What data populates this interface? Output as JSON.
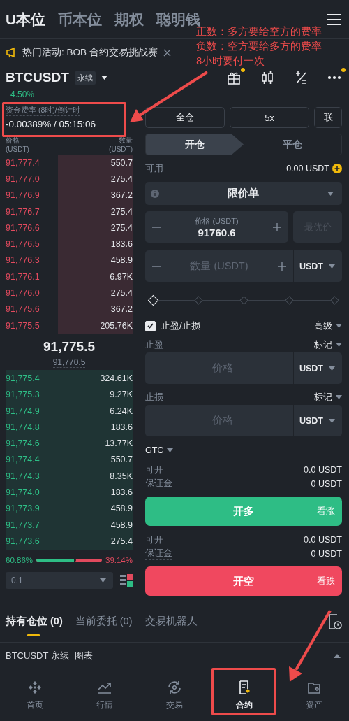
{
  "top_tabs": [
    {
      "label": "U本位",
      "selected": true
    },
    {
      "label": "币本位",
      "selected": false
    },
    {
      "label": "期权",
      "selected": false
    },
    {
      "label": "聪明钱",
      "selected": false
    }
  ],
  "announcement": {
    "text": "热门活动: BOB 合约交易挑战赛"
  },
  "symbol": {
    "name": "BTCUSDT",
    "tag": "永续",
    "change": "+4.50%"
  },
  "header_icons": [
    {
      "kind": "gift",
      "badge": true
    },
    {
      "kind": "candles",
      "badge": false
    },
    {
      "kind": "calculator",
      "badge": false
    },
    {
      "kind": "more",
      "badge": true
    }
  ],
  "funding": {
    "label": "资金费率 (8时)/倒计时",
    "value": "-0.00389% / 05:15:06"
  },
  "order_book": {
    "price_header": "价格",
    "price_unit": "(USDT)",
    "qty_header": "数量",
    "qty_unit": "(USDT)",
    "asks": [
      {
        "price": "91,777.4",
        "qty": "550.7"
      },
      {
        "price": "91,777.0",
        "qty": "275.4"
      },
      {
        "price": "91,776.9",
        "qty": "367.2"
      },
      {
        "price": "91,776.7",
        "qty": "275.4"
      },
      {
        "price": "91,776.6",
        "qty": "275.4"
      },
      {
        "price": "91,776.5",
        "qty": "183.6"
      },
      {
        "price": "91,776.3",
        "qty": "458.9"
      },
      {
        "price": "91,776.1",
        "qty": "6.97K"
      },
      {
        "price": "91,776.0",
        "qty": "275.4"
      },
      {
        "price": "91,775.6",
        "qty": "367.2"
      },
      {
        "price": "91,775.5",
        "qty": "205.76K"
      }
    ],
    "last_price": "91,775.5",
    "mark_price": "91,770.5",
    "bids": [
      {
        "price": "91,775.4",
        "qty": "324.61K"
      },
      {
        "price": "91,775.3",
        "qty": "9.27K"
      },
      {
        "price": "91,774.9",
        "qty": "6.24K"
      },
      {
        "price": "91,774.8",
        "qty": "183.6"
      },
      {
        "price": "91,774.6",
        "qty": "13.77K"
      },
      {
        "price": "91,774.4",
        "qty": "550.7"
      },
      {
        "price": "91,774.3",
        "qty": "8.35K"
      },
      {
        "price": "91,774.0",
        "qty": "183.6"
      },
      {
        "price": "91,773.9",
        "qty": "458.9"
      },
      {
        "price": "91,773.7",
        "qty": "458.9"
      },
      {
        "price": "91,773.6",
        "qty": "275.4"
      }
    ],
    "buy_ratio": {
      "text": "60.86%",
      "level": 0.6086
    },
    "sell_ratio": {
      "text": "39.14%"
    },
    "precision": "0.1"
  },
  "order_form": {
    "margin_mode": "全仓",
    "leverage": "5x",
    "position_mode": "联",
    "tabs": [
      {
        "label": "开仓",
        "selected": true
      },
      {
        "label": "平仓",
        "selected": false
      }
    ],
    "available_label": "可用",
    "available": "0.00 USDT",
    "order_type": "限价单",
    "price_label": "价格 (USDT)",
    "price": "91760.6",
    "best_price": "最优价",
    "qty_placeholder": "数量 (USDT)",
    "qty_unit": "USDT",
    "slider": {
      "level": 0
    },
    "tpsl": {
      "label": "止盈/止损",
      "checked": true,
      "advanced": "高级"
    },
    "take_profit": {
      "label": "止盈",
      "trigger": "标记",
      "placeholder": "价格",
      "unit": "USDT"
    },
    "stop_loss": {
      "label": "止损",
      "trigger": "标记",
      "placeholder": "价格",
      "unit": "USDT"
    },
    "time_in_force": "GTC",
    "long": {
      "rows": [
        {
          "label": "可开",
          "value": "0.0 USDT"
        },
        {
          "label": "保证金",
          "value": "0 USDT"
        }
      ],
      "button": "开多",
      "hint": "看涨"
    },
    "short": {
      "rows": [
        {
          "label": "可开",
          "value": "0.0 USDT"
        },
        {
          "label": "保证金",
          "value": "0 USDT"
        }
      ],
      "button": "开空",
      "hint": "看跌"
    }
  },
  "position_tabs": [
    {
      "label": "持有仓位 (0)",
      "selected": true
    },
    {
      "label": "当前委托 (0)",
      "selected": false
    },
    {
      "label": "交易机器人",
      "selected": false
    }
  ],
  "chart_bar": {
    "symbol": "BTCUSDT 永续",
    "label": "图表"
  },
  "bottom_nav": [
    {
      "label": "首页",
      "kind": "home",
      "selected": false
    },
    {
      "label": "行情",
      "kind": "markets",
      "selected": false
    },
    {
      "label": "交易",
      "kind": "trade",
      "selected": false
    },
    {
      "label": "合约",
      "kind": "futures",
      "selected": true
    },
    {
      "label": "资产",
      "kind": "assets",
      "selected": false
    }
  ],
  "annotations": {
    "notes": [
      "正数：多方要给空方的费率",
      "负数：空方要给多方的费率",
      "8小时要付一次"
    ]
  }
}
